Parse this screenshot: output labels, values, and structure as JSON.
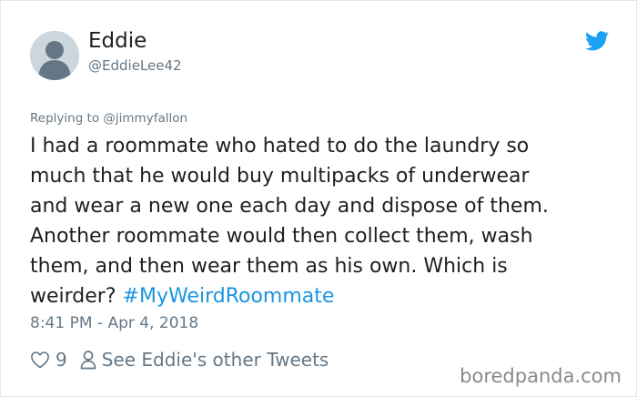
{
  "tweet": {
    "author_name": "Eddie",
    "author_handle": "@EddieLee42",
    "replying_prefix": "Replying to",
    "replying_handle": "@jimmyfallon",
    "text_lines": [
      "I had a roommate who hated to do the laundry so",
      "much that he would buy multipacks of underwear",
      "and wear a new one each day and dispose of them.",
      "Another roommate would then collect them, wash",
      "them, and then wear them as his own. Which is",
      "weirder?"
    ],
    "hashtag": "#MyWeirdRoommate",
    "timestamp": "8:41 PM - Apr 4, 2018",
    "like_count": "9",
    "other_tweets_label": "See Eddie's other Tweets"
  },
  "icons": {
    "avatar": "default-avatar-icon",
    "brand": "twitter-bird-icon",
    "like": "heart-icon",
    "profile": "person-icon"
  },
  "colors": {
    "brand_blue": "#1da1f2",
    "hashtag": "#1b95e0",
    "secondary_text": "#657786",
    "primary_text": "#1c2022"
  },
  "watermark": "boredpanda.com"
}
